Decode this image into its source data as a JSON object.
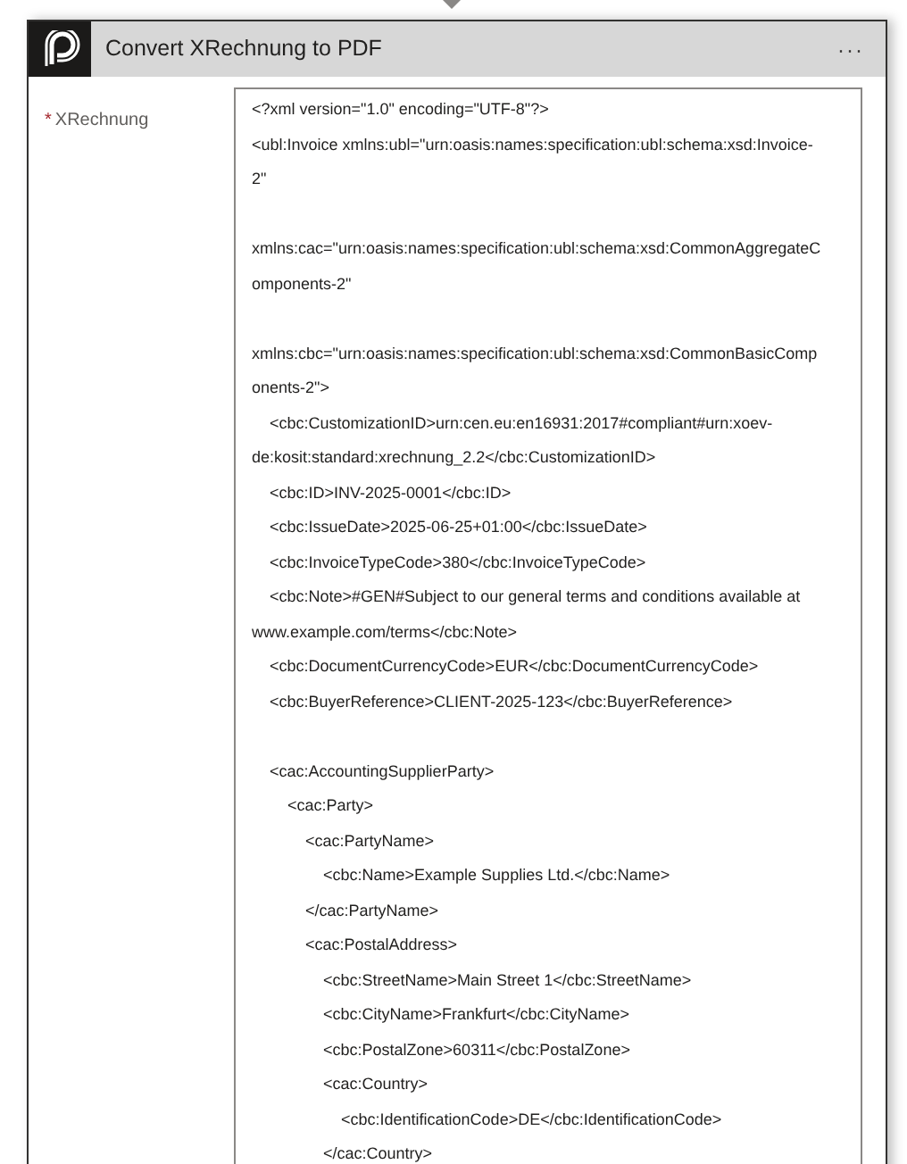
{
  "card": {
    "title": "Convert XRechnung to PDF",
    "menu": "···"
  },
  "field": {
    "required_mark": "*",
    "label": "XRechnung",
    "blocks": [
      [
        "<?xml version=\"1.0\" encoding=\"UTF-8\"?>",
        "<ubl:Invoice xmlns:ubl=\"urn:oasis:names:specification:ubl:schema:xsd:Invoice-",
        "2\""
      ],
      [
        "xmlns:cac=\"urn:oasis:names:specification:ubl:schema:xsd:CommonAggregateC",
        "omponents-2\""
      ],
      [
        "xmlns:cbc=\"urn:oasis:names:specification:ubl:schema:xsd:CommonBasicComp",
        "onents-2\">",
        "    <cbc:CustomizationID>urn:cen.eu:en16931:2017#compliant#urn:xoev-",
        "de:kosit:standard:xrechnung_2.2</cbc:CustomizationID>",
        "    <cbc:ID>INV-2025-0001</cbc:ID>",
        "    <cbc:IssueDate>2025-06-25+01:00</cbc:IssueDate>",
        "    <cbc:InvoiceTypeCode>380</cbc:InvoiceTypeCode>",
        "    <cbc:Note>#GEN#Subject to our general terms and conditions available at",
        "www.example.com/terms</cbc:Note>",
        "    <cbc:DocumentCurrencyCode>EUR</cbc:DocumentCurrencyCode>",
        "    <cbc:BuyerReference>CLIENT-2025-123</cbc:BuyerReference>"
      ],
      [
        "    <cac:AccountingSupplierParty>",
        "        <cac:Party>",
        "            <cac:PartyName>",
        "                <cbc:Name>Example Supplies Ltd.</cbc:Name>",
        "            </cac:PartyName>",
        "            <cac:PostalAddress>",
        "                <cbc:StreetName>Main Street 1</cbc:StreetName>",
        "                <cbc:CityName>Frankfurt</cbc:CityName>",
        "                <cbc:PostalZone>60311</cbc:PostalZone>",
        "                <cac:Country>",
        "                    <cbc:IdentificationCode>DE</cbc:IdentificationCode>",
        "                </cac:Country>"
      ]
    ]
  }
}
